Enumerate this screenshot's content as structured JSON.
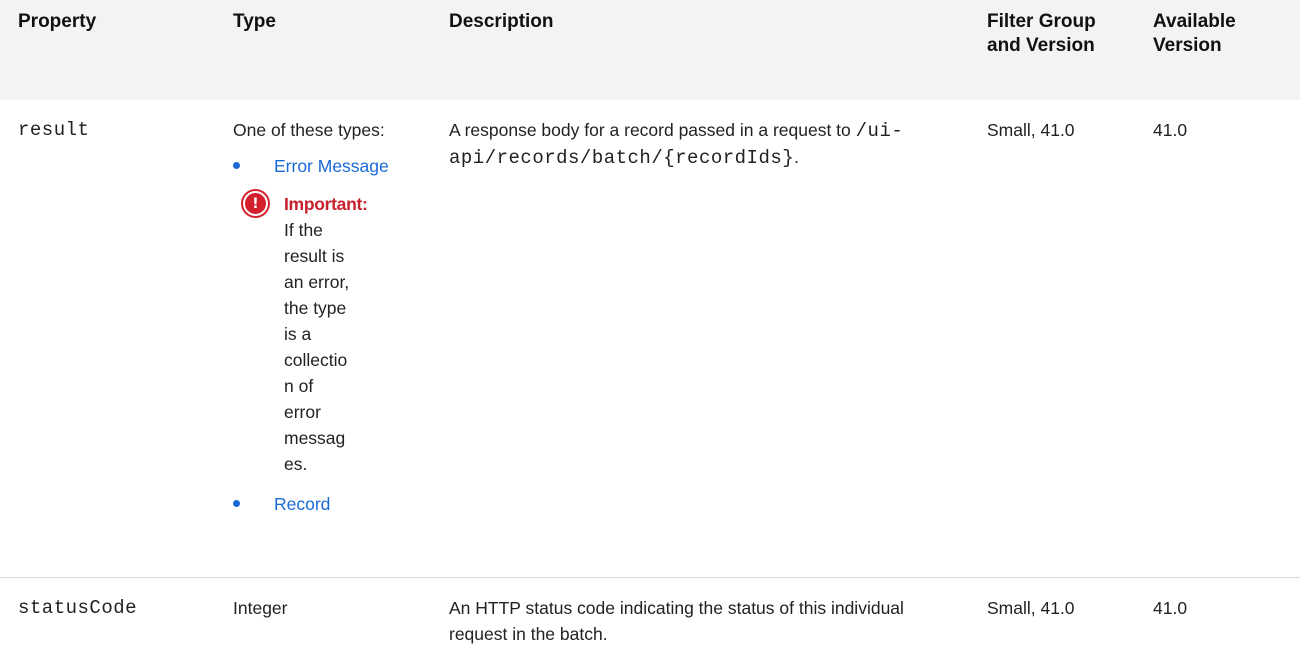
{
  "headers": {
    "property": "Property",
    "type": "Type",
    "description": "Description",
    "filter_group_line1": "Filter Group",
    "filter_group_line2": "and Version",
    "available_line1": "Available",
    "available_line2": "Version"
  },
  "rows": [
    {
      "property": "result",
      "type_intro": "One of these types:",
      "type_items": [
        "Error Message",
        "Record"
      ],
      "important_label": "Important:",
      "important_text": "If the result is an error, the type is a collection of error messages.",
      "description_text": "A response body for a record passed in a request to",
      "description_code": "/ui-api/records/batch/{recordIds}",
      "description_end": ".",
      "filter_group": "Small, 41.0",
      "available_version": "41.0"
    },
    {
      "property": "statusCode",
      "type": "Integer",
      "description": "An HTTP status code indicating the status of this individual request in the batch.",
      "filter_group": "Small, 41.0",
      "available_version": "41.0"
    }
  ],
  "colors": {
    "link": "#1a6ad6",
    "important": "#d41f2c",
    "header_bg": "#f3f3f3",
    "divider": "#d9d9d9"
  },
  "icons": {
    "bullet": "bullet-icon",
    "important": "important-exclamation-icon"
  }
}
